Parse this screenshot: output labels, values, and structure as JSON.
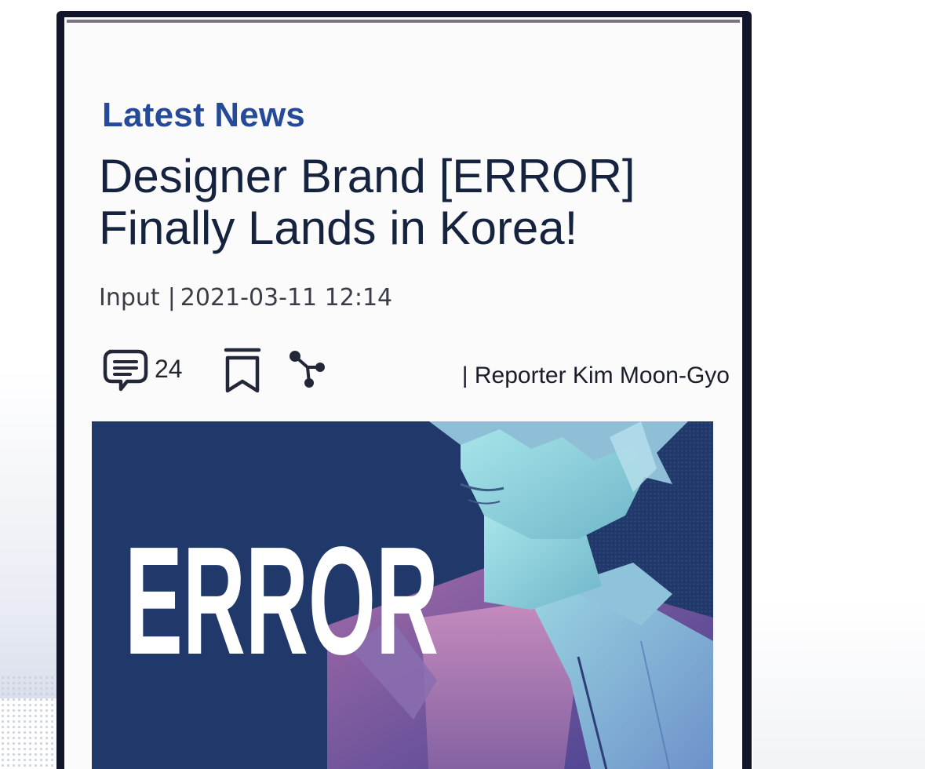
{
  "article": {
    "section_label": "Latest News",
    "headline_line1": "Designer Brand [ERROR]",
    "headline_line2": "Finally Lands in Korea!",
    "input_label": "Input",
    "separator": "|",
    "timestamp": "2021-03-11 12:14",
    "comment_count": "24",
    "reporter": "| Reporter Kim Moon-Gyo",
    "hero_title_text": "ERROR"
  },
  "icons": {
    "comment": "comment-bubble-icon",
    "bookmark": "bookmark-icon",
    "share": "share-icon"
  },
  "colors": {
    "section_label": "#264a9a",
    "headline": "#15233f",
    "frame": "#11162a",
    "hero_background": "#21386a"
  }
}
